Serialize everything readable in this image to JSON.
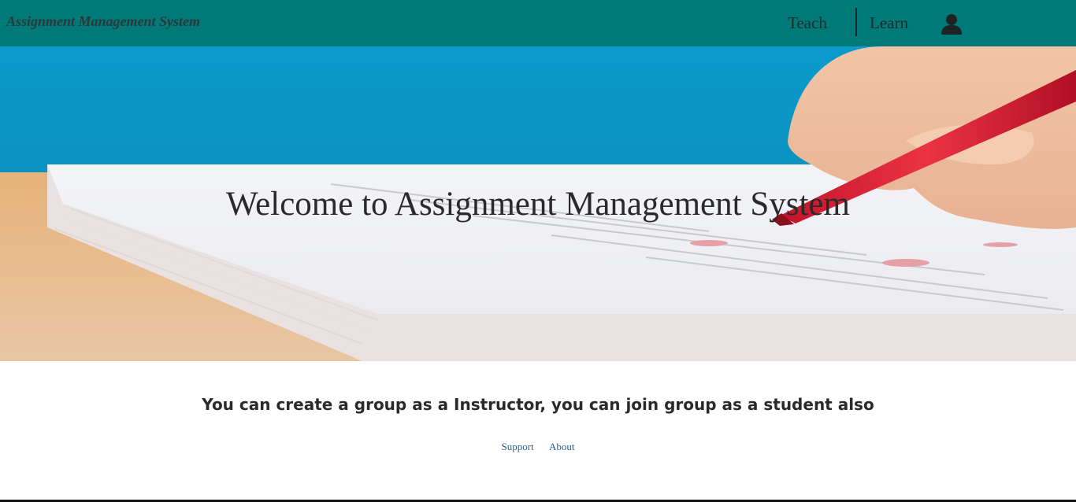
{
  "navbar": {
    "brand": "Assignment Management System",
    "links": [
      {
        "label": "Teach"
      },
      {
        "label": "Learn"
      }
    ],
    "user_icon": "user-icon"
  },
  "hero": {
    "title": "Welcome to Assignment Management System",
    "image": "hand-writing-on-paper-stack"
  },
  "main": {
    "tagline": "You can create a group as a Instructor, you can join group as a student also"
  },
  "footer": {
    "links": [
      {
        "label": "Support"
      },
      {
        "label": "About"
      }
    ]
  },
  "colors": {
    "navbar_bg": "#007a78",
    "hero_sky": "#0896c4",
    "link": "#2f5d8a"
  }
}
